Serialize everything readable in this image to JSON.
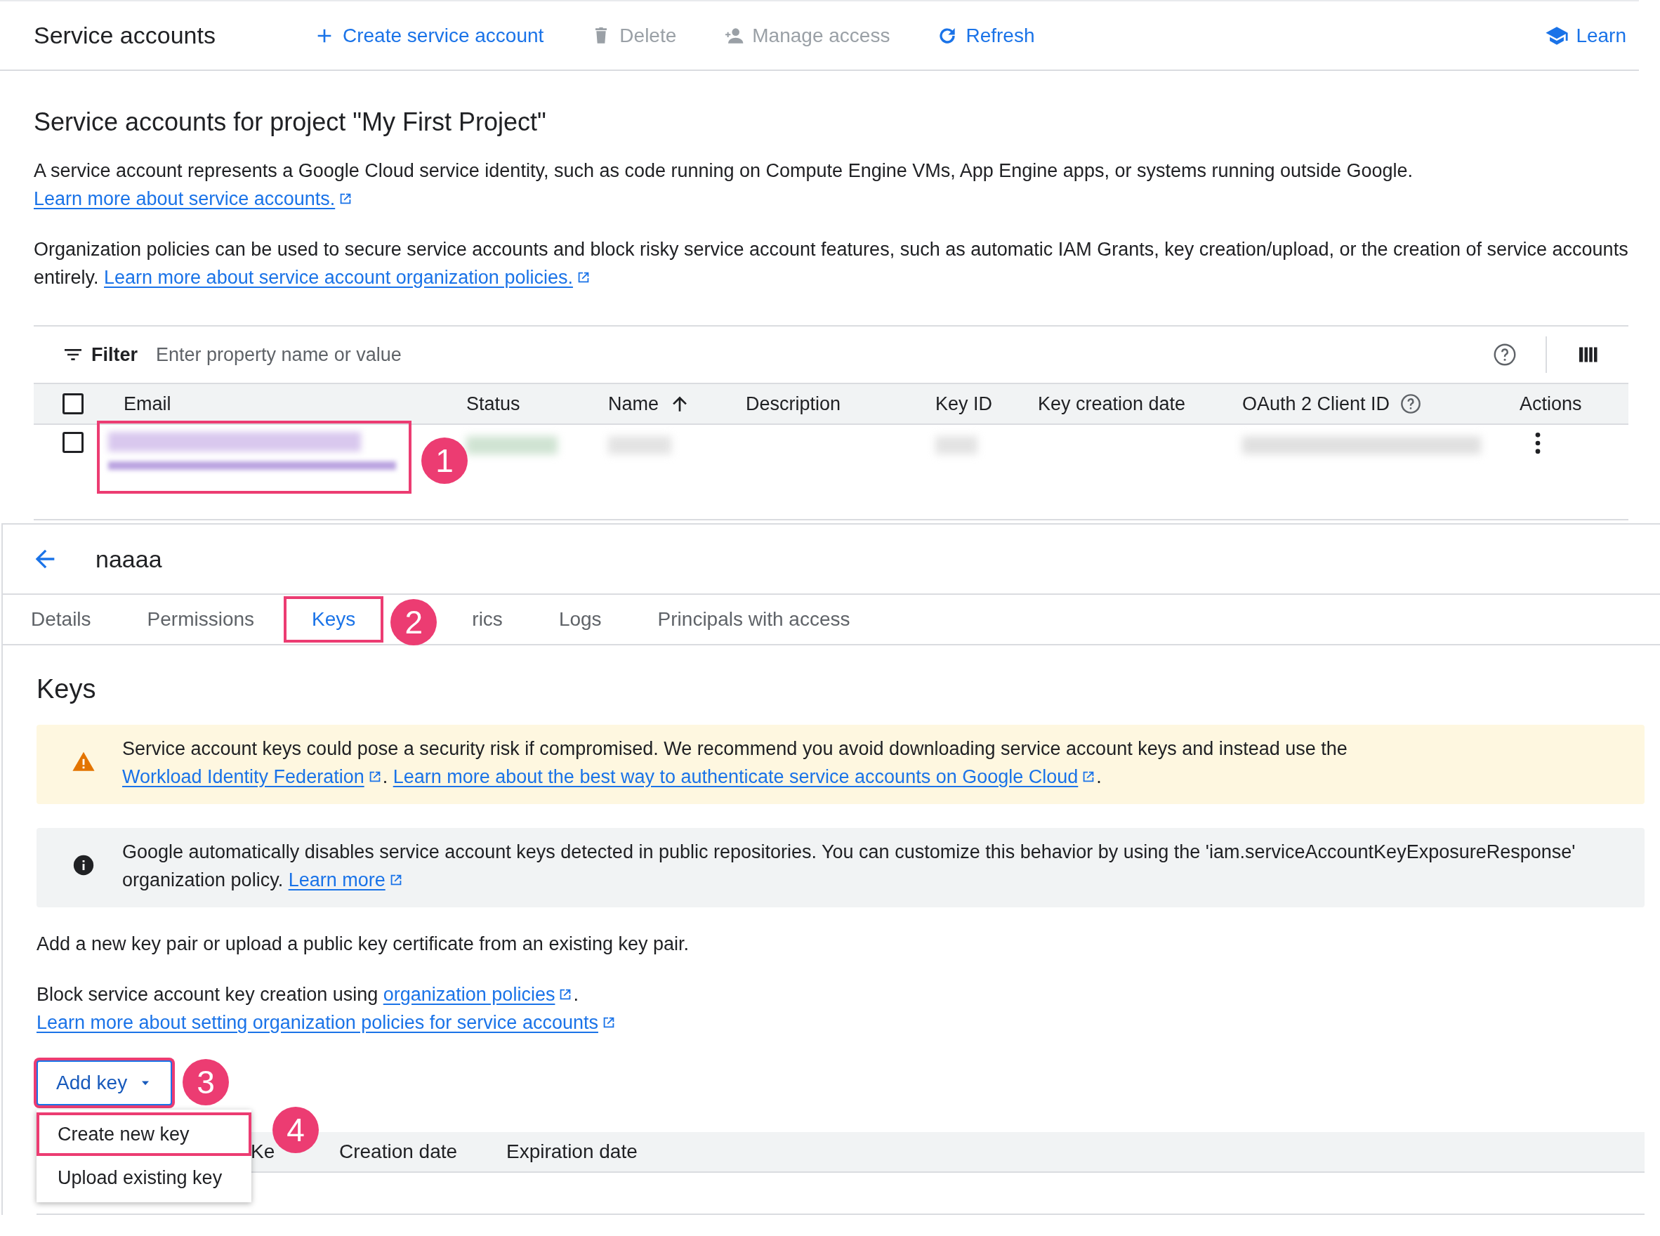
{
  "toolbar": {
    "title": "Service accounts",
    "actions": [
      {
        "kind": "add",
        "label": "Create service account",
        "disabled": false
      },
      {
        "kind": "delete",
        "label": "Delete",
        "disabled": true
      },
      {
        "kind": "person",
        "label": "Manage access",
        "disabled": true
      },
      {
        "kind": "refresh",
        "label": "Refresh",
        "disabled": false
      }
    ],
    "learn": "Learn"
  },
  "intro": {
    "heading": "Service accounts for project \"My First Project\"",
    "paragraphs": [
      {
        "text": "A service account represents a Google Cloud service identity, such as code running on Compute Engine VMs, App Engine apps, or systems running outside Google. ",
        "link": "Learn more about service accounts."
      },
      {
        "text": "Organization policies can be used to secure service accounts and block risky service account features, such as automatic IAM Grants, key creation/upload, or the creation of service accounts entirely. ",
        "link": "Learn more about service account organization policies."
      }
    ]
  },
  "filter": {
    "label": "Filter",
    "placeholder": "Enter property name or value"
  },
  "table": {
    "header_checked": false,
    "columns": [
      {
        "label": "Email"
      },
      {
        "label": "Status"
      },
      {
        "label": "Name",
        "sorted": true
      },
      {
        "label": "Description"
      },
      {
        "label": "Key ID"
      },
      {
        "label": "Key creation date"
      },
      {
        "label": "OAuth 2 Client ID",
        "help": true
      },
      {
        "label": "Actions"
      }
    ],
    "rows": [
      {
        "checked": false,
        "highlighted": true,
        "badge": "1"
      }
    ]
  },
  "details": {
    "title": "naaaa",
    "tabs": [
      {
        "label": "Details",
        "selected": false,
        "highlighted": false
      },
      {
        "label": "Permissions",
        "selected": false,
        "highlighted": false
      },
      {
        "label": "Keys",
        "selected": true,
        "highlighted": true,
        "badge": "2"
      },
      {
        "label": "rics",
        "selected": false,
        "highlighted": false
      },
      {
        "label": "Logs",
        "selected": false,
        "highlighted": false
      },
      {
        "label": "Principals with access",
        "selected": false,
        "highlighted": false
      }
    ]
  },
  "keys": {
    "heading": "Keys",
    "notices": [
      {
        "kind": "warning",
        "segments": [
          {
            "text": "Service account keys could pose a security risk if compromised. We recommend you avoid downloading service account keys and instead use the "
          },
          {
            "link": "Workload Identity Federation"
          },
          {
            "text": ". "
          },
          {
            "link": "Learn more about the best way to authenticate service accounts on Google Cloud"
          },
          {
            "text": "."
          }
        ]
      },
      {
        "kind": "info",
        "segments": [
          {
            "text": "Google automatically disables service account keys detected in public repositories. You can customize this behavior by using the 'iam.serviceAccountKeyExposureResponse' organization policy. "
          },
          {
            "link": "Learn more"
          }
        ]
      }
    ],
    "paragraphs": [
      {
        "segments": [
          {
            "text": "Add a new key pair or upload a public key certificate from an existing key pair."
          }
        ]
      },
      {
        "segments": [
          {
            "text": "Block service account key creation using "
          },
          {
            "link": "organization policies"
          },
          {
            "text": "."
          }
        ]
      },
      {
        "segments": [
          {
            "link": "Learn more about setting organization policies for service accounts"
          }
        ]
      }
    ],
    "add_button": {
      "label": "Add key",
      "highlighted": true,
      "badge": "3"
    },
    "menu": [
      {
        "label": "Create new key",
        "highlighted": true,
        "badge": "4"
      },
      {
        "label": "Upload existing key",
        "highlighted": false
      }
    ],
    "columns": [
      "Ke",
      "Creation date",
      "Expiration date"
    ]
  }
}
